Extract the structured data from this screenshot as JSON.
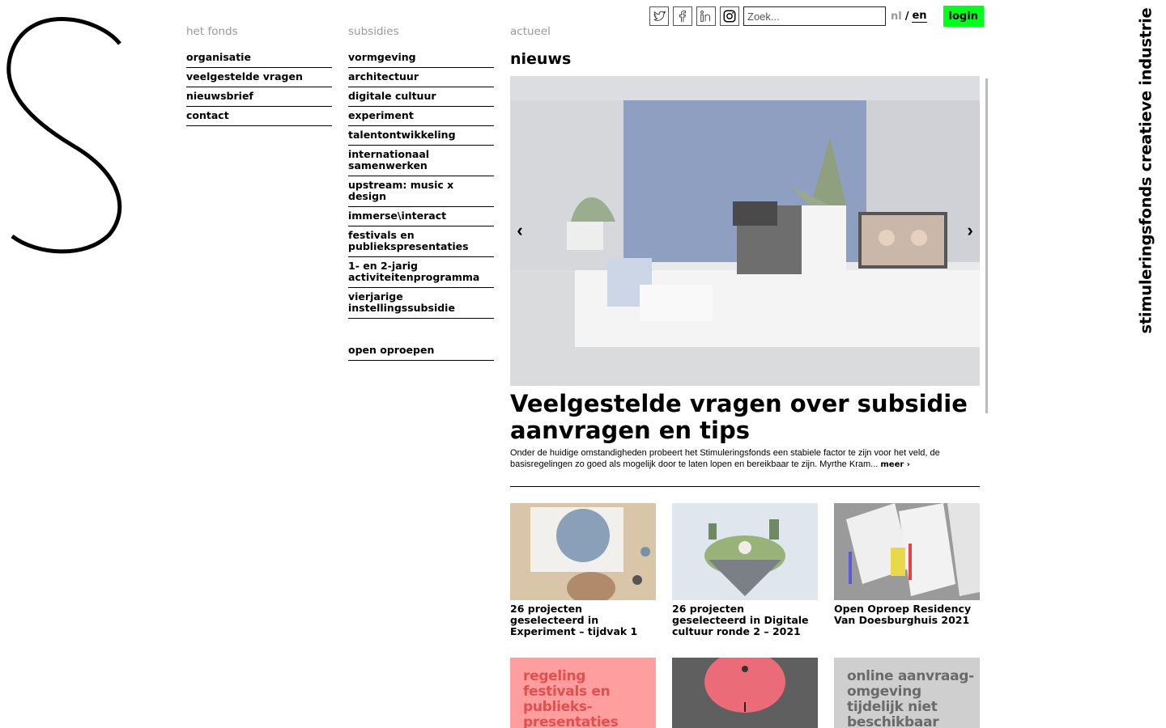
{
  "brand": {
    "vertical_name": "stimuleringsfonds creatieve industrie"
  },
  "topbar": {
    "social": [
      "twitter-icon",
      "facebook-icon",
      "linkedin-icon",
      "instagram-icon"
    ],
    "search_placeholder": "Zoek...",
    "lang_nl": "nl",
    "lang_sep": "/",
    "lang_en": "en",
    "login_label": "login",
    "login_color": "#00ff1a"
  },
  "nav": {
    "het_fonds": {
      "heading": "het fonds",
      "items": [
        "organisatie",
        "veelgestelde vragen",
        "nieuwsbrief",
        "contact"
      ]
    },
    "subsidies": {
      "heading": "subsidies",
      "items": [
        "vormgeving",
        "architectuur",
        "digitale cultuur",
        "experiment",
        "talentontwikkeling",
        "internationaal samenwerken",
        "upstream: music x design",
        "immerse\\interact",
        "festivals en publiekspresentaties",
        "1- en 2-jarig activiteitenprogramma",
        "vierjarige instellingssubsidie",
        "open oproepen"
      ]
    },
    "actueel": {
      "heading": "actueel"
    }
  },
  "news": {
    "section_title": "nieuws",
    "carousel_prev": "‹",
    "carousel_next": "›",
    "headline": "Veelgestelde vragen over subsidie aanvragen en tips",
    "summary": "Onder de huidige omstandigheden probeert het Stimuleringsfonds een stabiele factor te zijn voor het veld, de basisregelingen zo goed als mogelijk door te laten lopen en bereikbaar te zijn. Myrthe Kram...",
    "more_label": "meer ›"
  },
  "cards": [
    {
      "caption": "26 projecten geselecteerd in Experiment – tijdvak 1"
    },
    {
      "caption": "26 projecten geselecteerd in Digitale cultuur ronde 2 – 2021"
    },
    {
      "caption": "Open Oproep Residency Van Doesburghuis 2021"
    }
  ],
  "tiles": [
    {
      "text": "regeling festivals en publieks-presentaties",
      "color": "#ff9e9e"
    },
    {
      "text": "",
      "color": "#7a7a7a"
    },
    {
      "text": "online aanvraag-omgeving tijdelijk niet beschikbaar",
      "color": "#cfcfcf"
    }
  ]
}
